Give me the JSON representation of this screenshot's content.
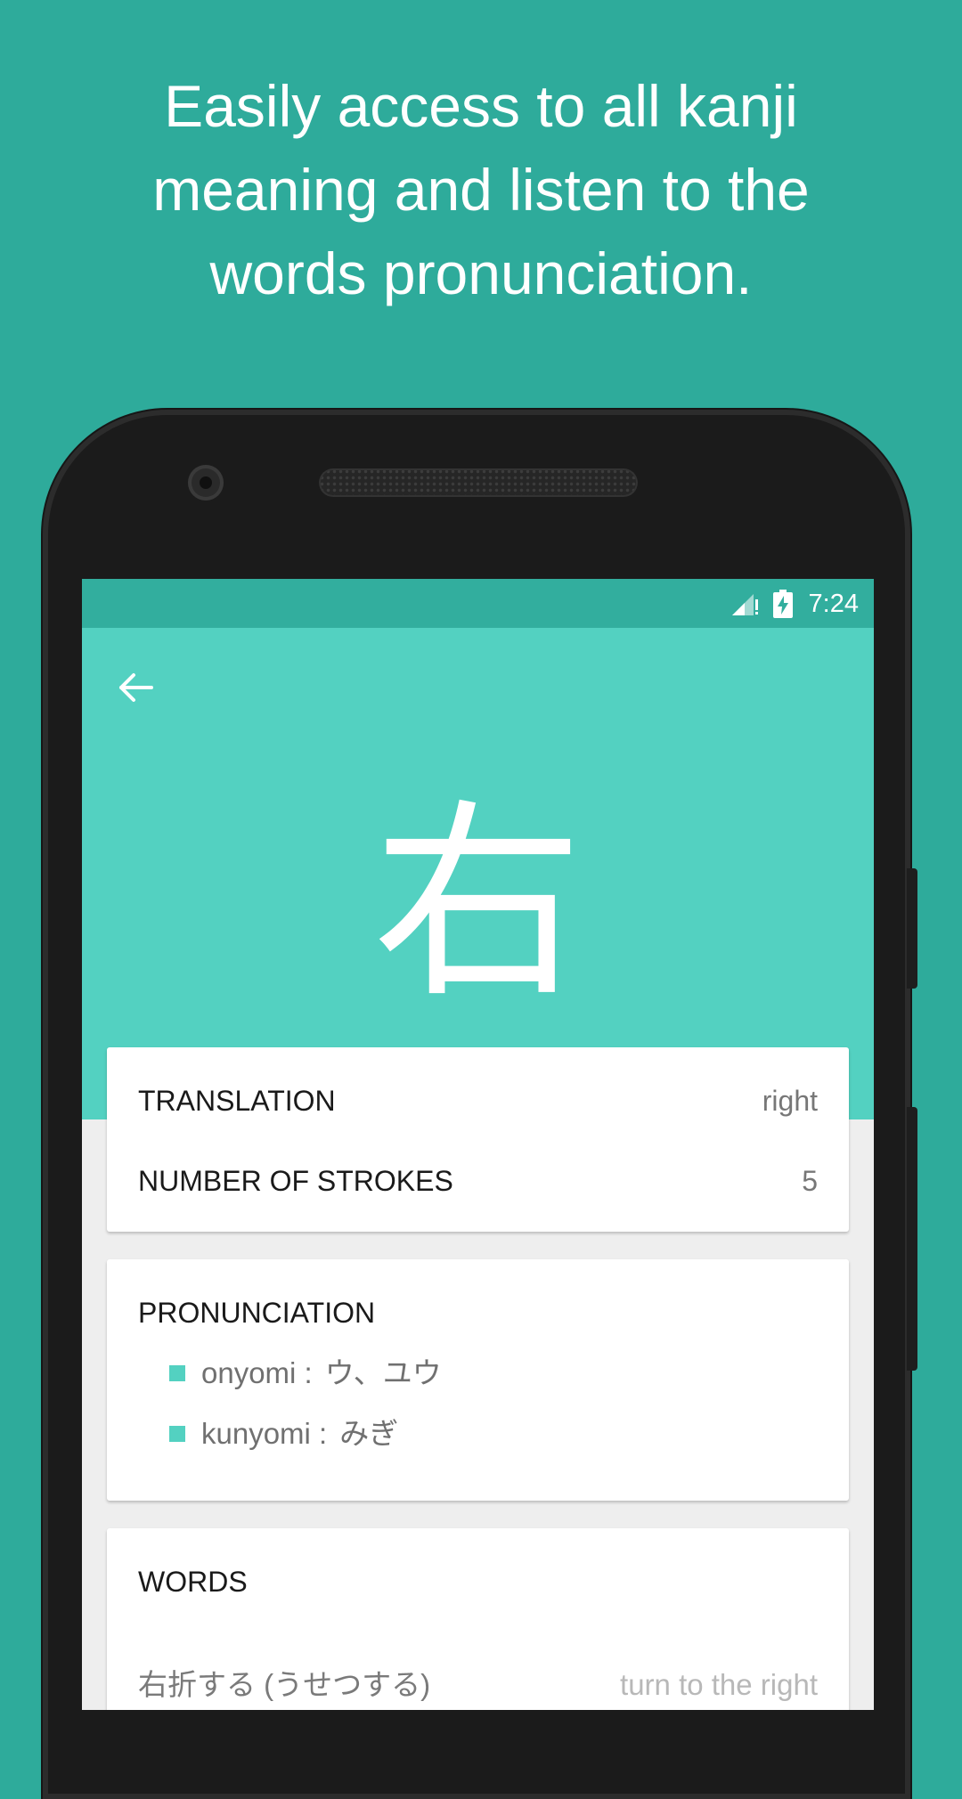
{
  "promo": {
    "heading_line1": "Easily access to all kanji",
    "heading_line2": "meaning and listen to the",
    "heading_line3": "words pronunciation."
  },
  "status_bar": {
    "time": "7:24",
    "signal_icon": "signal-no-data-icon",
    "battery_icon": "battery-charging-icon"
  },
  "toolbar": {
    "back_icon": "arrow-left-icon"
  },
  "kanji": {
    "character": "右"
  },
  "summary": {
    "translation_label": "TRANSLATION",
    "translation_value": "right",
    "strokes_label": "NUMBER OF STROKES",
    "strokes_value": "5"
  },
  "pronunciation": {
    "title": "PRONUNCIATION",
    "readings": [
      {
        "label": "onyomi :",
        "value": "ウ、ユウ"
      },
      {
        "label": "kunyomi :",
        "value": "みぎ"
      }
    ]
  },
  "words": {
    "title": "WORDS",
    "items": [
      {
        "word": "右折する (うせつする)",
        "meaning": "turn to the right"
      }
    ]
  },
  "colors": {
    "background": "#2eab9b",
    "status_bar": "#32ae9e",
    "header": "#53d1c1",
    "accent": "#53d1c1"
  }
}
